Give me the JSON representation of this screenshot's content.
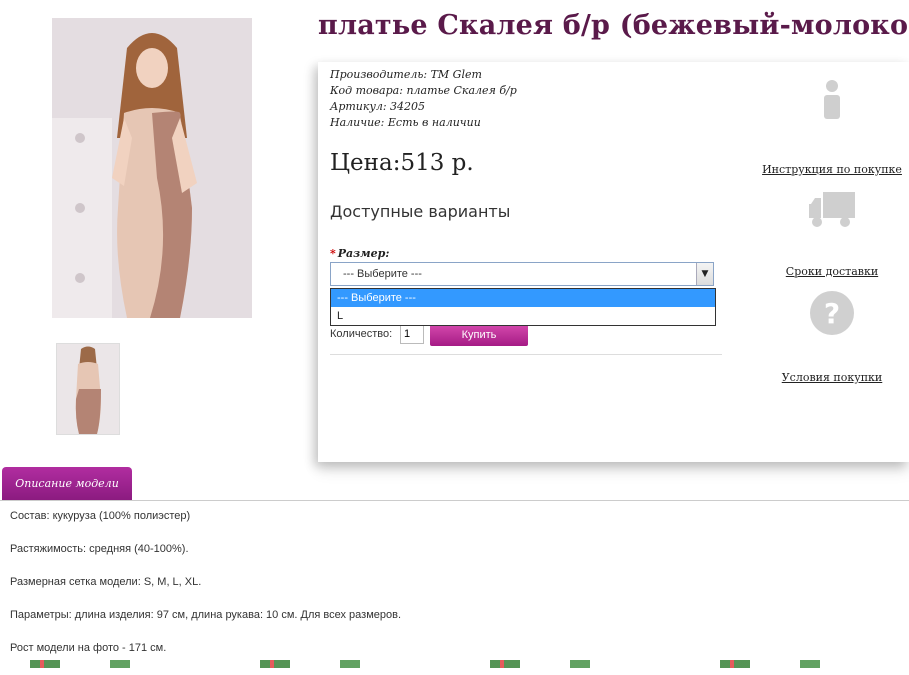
{
  "product": {
    "title": "платье Скалея б/р (бежевый-молоко)",
    "meta": [
      {
        "label": "Производитель:",
        "value": "TM Glem"
      },
      {
        "label": "Код товара:",
        "value": "платье Скалея б/р"
      },
      {
        "label": "Артикул:",
        "value": "34205"
      },
      {
        "label": "Наличие:",
        "value": "Есть в наличии"
      }
    ],
    "price": "Цена:513 р.",
    "variants_heading": "Доступные варианты",
    "size_label": "Размер:",
    "size_required_mark": "*",
    "size_select": {
      "value": "--- Выберите ---",
      "options": [
        "--- Выберите ---",
        "L"
      ]
    },
    "quantity_label": "Количество:",
    "quantity_value": "1",
    "buy_label": "Купить"
  },
  "side": {
    "instructions": "Инструкция по покупке",
    "delivery": "Сроки доставки",
    "conditions": "Условия покупки"
  },
  "tab": {
    "label": "Описание модели"
  },
  "description": [
    {
      "key": "Состав:",
      "value": "кукуруза (100% полиэстер)"
    },
    {
      "key": "Растяжимость:",
      "value": "средняя (40-100%)."
    },
    {
      "key": "Размерная сетка модели:",
      "value": "S, M, L, XL."
    },
    {
      "key": "Параметры:",
      "value": "длина изделия: 97 см, длина рукава: 10 см. Для всех размеров."
    },
    {
      "key": "",
      "value": "Рост модели на фото - 171 см."
    }
  ],
  "colors": {
    "title": "#5a1a4a",
    "accent": "#a51b85",
    "dropdown_selected": "#3399ff"
  }
}
